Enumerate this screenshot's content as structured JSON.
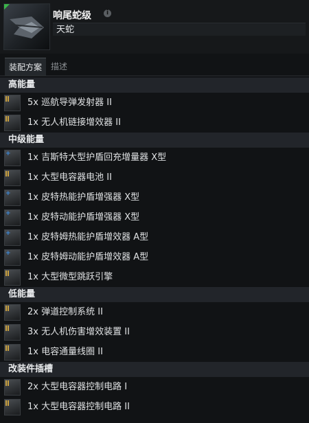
{
  "ship": {
    "name": "响尾蛇级",
    "type": "天蛇",
    "info_icon": "i"
  },
  "tabs": [
    {
      "label": "装配方案",
      "active": true
    },
    {
      "label": "描述",
      "active": false
    }
  ],
  "sections": [
    {
      "title": "高能量",
      "items": [
        {
          "label": "5x 巡航导弹发射器 II",
          "icon": "launcher-icon"
        },
        {
          "label": "1x 无人机链接增效器 II",
          "icon": "drone-link-icon"
        }
      ]
    },
    {
      "title": "中级能量",
      "items": [
        {
          "label": "1x 吉斯特大型护盾回充增量器 X型",
          "icon": "shield-booster-icon"
        },
        {
          "label": "1x 大型电容器电池 II",
          "icon": "cap-battery-icon"
        },
        {
          "label": "1x 皮特热能护盾增强器 X型",
          "icon": "thermal-hardener-icon"
        },
        {
          "label": "1x 皮特动能护盾增强器 X型",
          "icon": "kinetic-hardener-icon"
        },
        {
          "label": "1x 皮特姆热能护盾增效器 A型",
          "icon": "thermal-amplifier-icon"
        },
        {
          "label": "1x 皮特姆动能护盾增效器 A型",
          "icon": "kinetic-amplifier-icon"
        },
        {
          "label": "1x 大型微型跳跃引擎",
          "icon": "micro-jump-icon"
        }
      ]
    },
    {
      "title": "低能量",
      "items": [
        {
          "label": "2x 弹道控制系统 II",
          "icon": "ballistic-control-icon"
        },
        {
          "label": "3x 无人机伤害增效装置 II",
          "icon": "drone-damage-icon"
        },
        {
          "label": "1x 电容通量线圈 II",
          "icon": "flux-coil-icon"
        }
      ]
    },
    {
      "title": "改装件插槽",
      "items": [
        {
          "label": "2x 大型电容器控制电路 I",
          "icon": "cap-control-rig-icon"
        },
        {
          "label": "1x 大型电容器控制电路 II",
          "icon": "cap-control-rig-icon"
        }
      ]
    }
  ],
  "colors": {
    "section_bg": "#22252a",
    "background": "#111315",
    "tech_bar": "#c8a040",
    "faction_plus": "#3a8ce0"
  }
}
